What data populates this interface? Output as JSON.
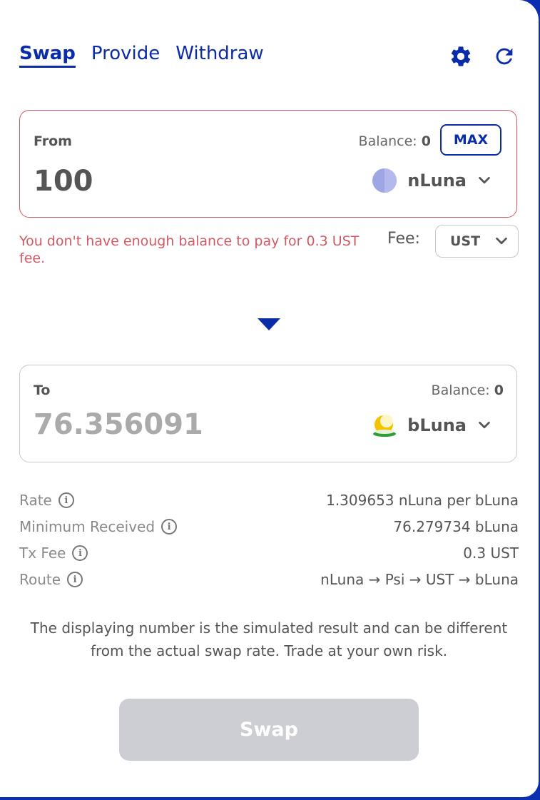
{
  "tabs": [
    {
      "label": "Swap",
      "active": true
    },
    {
      "label": "Provide",
      "active": false
    },
    {
      "label": "Withdraw",
      "active": false
    }
  ],
  "header_icons": [
    "gear-icon",
    "refresh-icon"
  ],
  "from": {
    "label": "From",
    "balance_label": "Balance:",
    "balance_value": "0",
    "max_label": "MAX",
    "amount": "100",
    "token": "nLuna"
  },
  "error_message": "You don't have enough balance to pay for 0.3 UST fee.",
  "fee": {
    "label": "Fee:",
    "selected": "UST"
  },
  "to": {
    "label": "To",
    "balance_label": "Balance:",
    "balance_value": "0",
    "amount": "76.356091",
    "token": "bLuna"
  },
  "info": {
    "rate_label": "Rate",
    "rate_value": "1.309653 nLuna per bLuna",
    "min_label": "Minimum Received",
    "min_value": "76.279734 bLuna",
    "txfee_label": "Tx Fee",
    "txfee_value": "0.3 UST",
    "route_label": "Route",
    "route_value": "nLuna → Psi → UST → bLuna"
  },
  "disclaimer_line1": "The displaying number is the simulated result and can be different",
  "disclaimer_line2": "from the actual swap rate. Trade at your own risk.",
  "swap_button": "Swap",
  "colors": {
    "accent": "#0b2ca8",
    "error": "#d05a63",
    "disabled_button": "#cdced3"
  }
}
